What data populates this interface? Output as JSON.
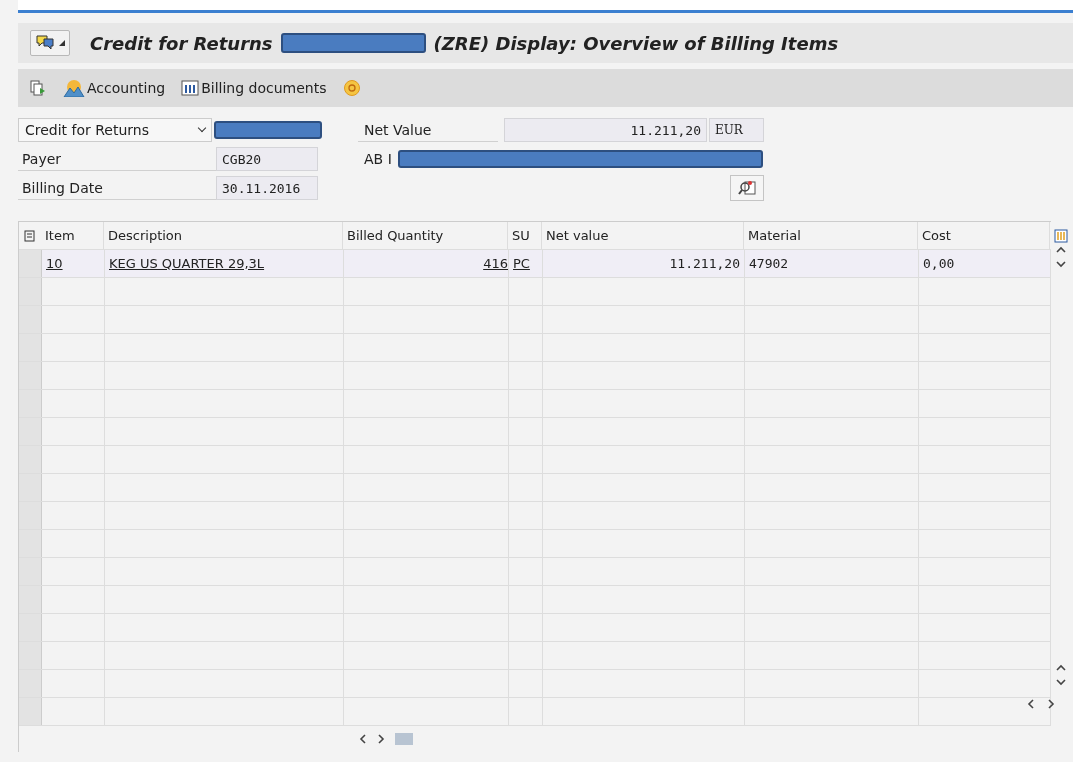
{
  "window": {
    "title_start": "Credit for Returns",
    "title_end": "(ZRE) Display: Overview of Billing Items"
  },
  "toolbar": [
    {
      "kind": "doc"
    },
    {
      "kind": "accounting",
      "label": "Accounting"
    },
    {
      "kind": "billing",
      "label": "Billing documents"
    },
    {
      "kind": "coin"
    }
  ],
  "header": {
    "doc_type": "Credit for Returns",
    "payer_label": "Payer",
    "payer": "CGB20",
    "date_label": "Billing Date",
    "date": "30.11.2016",
    "net_label": "Net Value",
    "net_value": "11.211,20",
    "currency": "EUR",
    "partner_label": "AB I"
  },
  "table": {
    "columns": [
      "Item",
      "Description",
      "Billed Quantity",
      "SU",
      "Net value",
      "Material",
      "Cost"
    ],
    "rows": [
      {
        "item": "10",
        "description": "KEG US QUARTER 29,3L",
        "quantity": "416",
        "su": "PC",
        "net_value": "11.211,20",
        "material": "47902",
        "cost": "0,00"
      }
    ]
  }
}
